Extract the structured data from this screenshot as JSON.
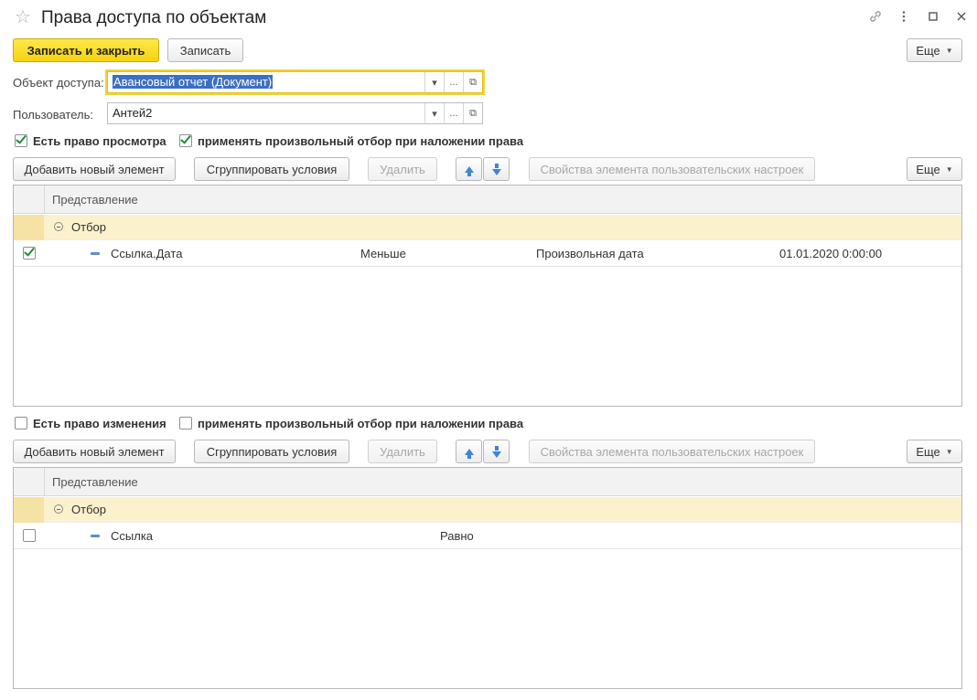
{
  "window": {
    "title": "Права доступа по объектам",
    "icons": [
      "star-icon",
      "link-icon",
      "more-vertical-icon",
      "maximize-icon",
      "close-icon"
    ]
  },
  "toolbar": {
    "save_close_label": "Записать и закрыть",
    "save_label": "Записать",
    "more_label": "Еще"
  },
  "form": {
    "object_label": "Объект доступа:",
    "object_value": "Авансовый отчет (Документ)",
    "user_label": "Пользователь:",
    "user_value": "Антей2",
    "dropdown_glyph": "▾",
    "ellipsis_glyph": "...",
    "open_glyph": "⧉"
  },
  "view_section": {
    "right_label": "Есть право просмотра",
    "right_checked": true,
    "filter_label": "применять произвольный отбор при наложении права",
    "filter_checked": true,
    "buttons": {
      "add": "Добавить новый элемент",
      "group": "Сгруппировать условия",
      "delete": "Удалить",
      "properties": "Свойства элемента пользовательских настроек",
      "more": "Еще"
    },
    "table": {
      "header": "Представление",
      "group": "Отбор",
      "rows": [
        {
          "checked": true,
          "field": "Ссылка.Дата",
          "comparison": "Меньше",
          "type": "Произвольная дата",
          "value": "01.01.2020 0:00:00"
        }
      ]
    }
  },
  "edit_section": {
    "right_label": "Есть право изменения",
    "right_checked": false,
    "filter_label": "применять произвольный отбор при наложении права",
    "filter_checked": false,
    "buttons": {
      "add": "Добавить новый элемент",
      "group": "Сгруппировать условия",
      "delete": "Удалить",
      "properties": "Свойства элемента пользовательских настроек",
      "more": "Еще"
    },
    "table": {
      "header": "Представление",
      "group": "Отбор",
      "rows": [
        {
          "checked": false,
          "field": "Ссылка",
          "comparison": "Равно"
        }
      ]
    }
  },
  "colors": {
    "primary_button": "#f5d20e",
    "focus_outline": "#f2d236",
    "selection": "#3b6fc4",
    "group_row": "#fbf1cc",
    "checkmark": "#1e8f3a",
    "arrow": "#3b86d6"
  }
}
